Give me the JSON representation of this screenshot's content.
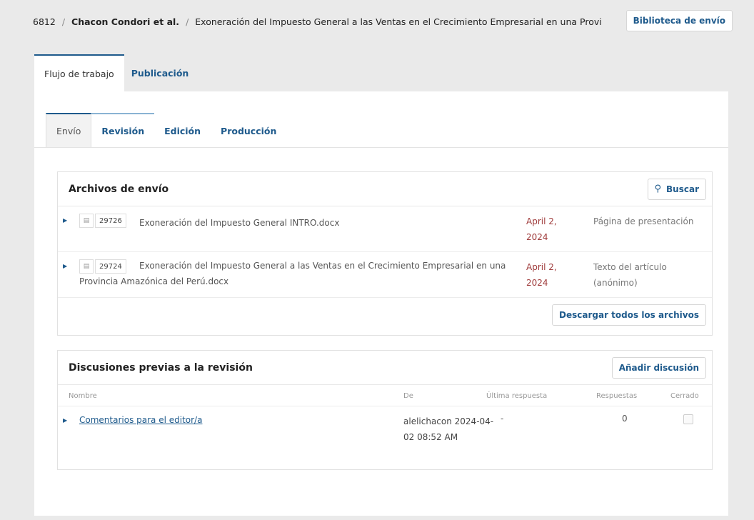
{
  "breadcrumb": {
    "id": "6812",
    "separator": "/",
    "author": "Chacon Condori et al.",
    "title": "Exoneración del Impuesto General a las Ventas en el Crecimiento Empresarial en una Provi"
  },
  "header": {
    "library_button": "Biblioteca de envío"
  },
  "main_tabs": [
    {
      "label": "Flujo de trabajo"
    },
    {
      "label": "Publicación"
    }
  ],
  "sub_tabs": [
    {
      "label": "Envío"
    },
    {
      "label": "Revisión"
    },
    {
      "label": "Edición"
    },
    {
      "label": "Producción"
    }
  ],
  "files": {
    "title": "Archivos de envío",
    "search_button": "Buscar",
    "download_all_button": "Descargar todos los archivos",
    "rows": [
      {
        "id": "29726",
        "name": "Exoneración del Impuesto General INTRO.docx",
        "date": "April 2, 2024",
        "type": "Página de presentación"
      },
      {
        "id": "29724",
        "name": "Exoneración del Impuesto General a las Ventas en el Crecimiento Empresarial en una Provincia Amazónica del Perú.docx",
        "date": "April 2, 2024",
        "type": "Texto del artículo (anónimo)"
      }
    ]
  },
  "discussions": {
    "title": "Discusiones previas a la revisión",
    "add_button": "Añadir discusión",
    "columns": {
      "name": "Nombre",
      "from": "De",
      "last_reply": "Última respuesta",
      "replies": "Respuestas",
      "closed": "Cerrado"
    },
    "rows": [
      {
        "name": "Comentarios para el editor/a",
        "from": "alelichacon 2024-04-02 08:52 AM",
        "last_reply": "-",
        "replies": "0"
      }
    ]
  },
  "icons": {
    "expand": "triangle-right-icon",
    "search": "search-icon",
    "document": "document-icon"
  },
  "colors": {
    "accent": "#1e5a8c",
    "date": "#a03c3c",
    "background": "#eaeaea"
  }
}
